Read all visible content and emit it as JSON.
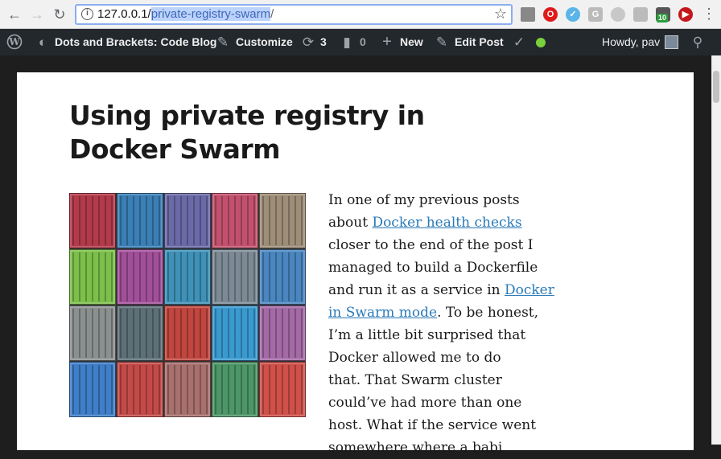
{
  "browser": {
    "url_host": "127.0.0.1/",
    "url_path": "private-registry-swarm",
    "url_trail": "/",
    "badge_count": "10"
  },
  "admin_bar": {
    "site_name": "Dots and Brackets: Code Blog",
    "customize": "Customize",
    "updates": "3",
    "comments": "0",
    "new": "New",
    "edit_post": "Edit Post",
    "greeting": "Howdy, pav"
  },
  "post": {
    "title": "Using private registry in Docker Swarm",
    "lines": [
      {
        "text": "In one of my previous posts",
        "links": []
      },
      {
        "pre": "about ",
        "link": "Docker health checks",
        "post": ""
      },
      {
        "text": "closer to the end of the post I"
      },
      {
        "text": "managed to build a Dockerfile"
      },
      {
        "pre": "and run it as a service in ",
        "link": "Docker",
        "post": ""
      },
      {
        "pre": "",
        "link": "in Swarm mode",
        "post": ". To be honest,"
      },
      {
        "text": "I’m a little bit surprised that"
      },
      {
        "text": "Docker allowed me to do"
      },
      {
        "text": "that. That Swarm cluster"
      },
      {
        "text": "could’ve had more than one"
      },
      {
        "text": "host. What if the service went"
      },
      {
        "text": "somewhere where a babi"
      }
    ]
  },
  "colors": {
    "admin_bar": "#23282d",
    "link": "#2a7ab8",
    "status_dot": "#7ad03a"
  }
}
